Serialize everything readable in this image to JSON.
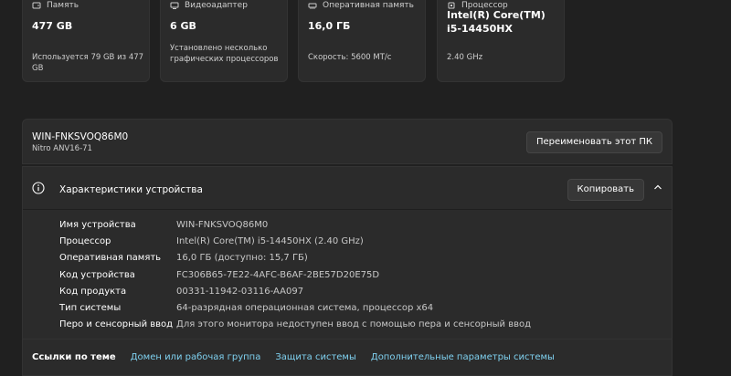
{
  "cards": {
    "storage": {
      "label": "Память",
      "value": "477 GB",
      "sub": [
        "Используется 79 GB из 477 GB"
      ]
    },
    "gpu": {
      "label": "Видеоадаптер",
      "value": "6 GB",
      "sub": [
        "Установлено несколько",
        "графических процессоров"
      ]
    },
    "ram": {
      "label": "Оперативная память",
      "value": "16,0 ГБ",
      "sub": [
        "Скорость: 5600 МТ/с"
      ]
    },
    "cpu": {
      "label": "Процессор",
      "value": [
        "Intel(R) Core(TM)",
        "i5-14450HX"
      ],
      "sub": [
        "2.40 GHz"
      ]
    }
  },
  "pc": {
    "name": "WIN-FNKSVOQ86M0",
    "model": "Nitro ANV16-71",
    "rename_label": "Переименовать этот ПК"
  },
  "specs": {
    "title": "Характеристики устройства",
    "copy_label": "Копировать",
    "rows": [
      {
        "key": "Имя устройства",
        "value": "WIN-FNKSVOQ86M0"
      },
      {
        "key": "Процессор",
        "value": "Intel(R) Core(TM) i5-14450HX (2.40 GHz)"
      },
      {
        "key": "Оперативная память",
        "value": "16,0 ГБ (доступно: 15,7 ГБ)"
      },
      {
        "key": "Код устройства",
        "value": "FC306B65-7E22-4AFC-B6AF-2BE57D20E75D"
      },
      {
        "key": "Код продукта",
        "value": "00331-11942-03116-AA097"
      },
      {
        "key": "Тип системы",
        "value": "64-разрядная операционная система, процессор x64"
      },
      {
        "key": "Перо и сенсорный ввод",
        "value": "Для этого монитора недоступен ввод с помощью пера и сенсорный ввод"
      }
    ]
  },
  "links": {
    "label": "Ссылки по теме",
    "items": [
      "Домен или рабочая группа",
      "Защита системы",
      "Дополнительные параметры системы"
    ]
  }
}
